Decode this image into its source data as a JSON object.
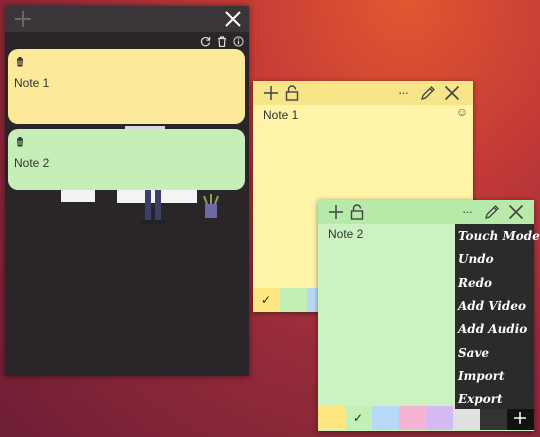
{
  "notes_list": {
    "items": [
      {
        "title": "Note 1",
        "color": "#fde99a"
      },
      {
        "title": "Note 2",
        "color": "#c6efb8"
      }
    ]
  },
  "sticky1": {
    "text": "Note 1",
    "color": "#fff4a8",
    "header_color": "#f7e58a",
    "menu_dots": "···"
  },
  "sticky2": {
    "text": "Note 2",
    "color": "#ccf2c2",
    "header_color": "#b7e9a8",
    "menu_dots": "···"
  },
  "color_swatches": [
    "#ffe680",
    "#c3f0b4",
    "#b9d8f7",
    "#f6b4d5",
    "#d5b9f2",
    "#e0e0e0",
    "#333333"
  ],
  "context_menu": {
    "items": [
      "Touch Mode",
      "Undo",
      "Redo",
      "Add Video",
      "Add Audio",
      "Save",
      "Import",
      "Export"
    ]
  },
  "icons": {
    "check": "✓",
    "smiley": "☺"
  }
}
